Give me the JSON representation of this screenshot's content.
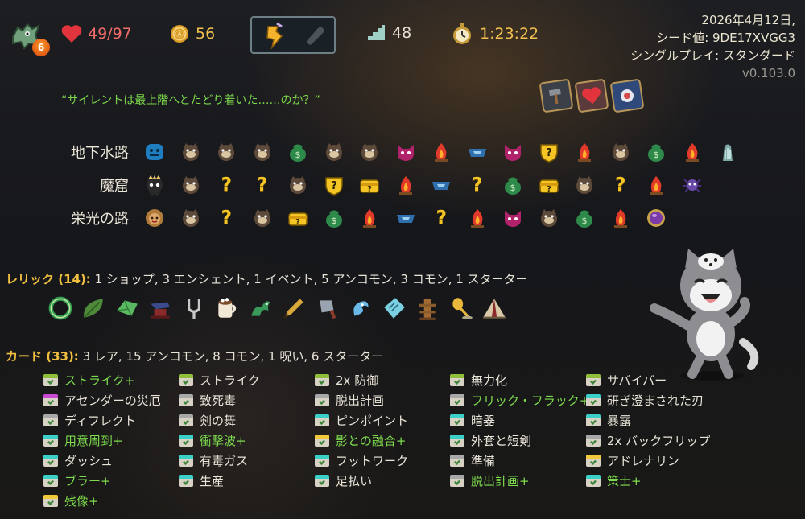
{
  "hud": {
    "ascension": "6",
    "hp": "49/97",
    "gold": "56",
    "floor": "48",
    "time": "1:23:22",
    "colors": {
      "hp": "#f26b6b",
      "gold": "#f2c04e",
      "upgraded": "#7ddc4d",
      "header": "#f0bf3f"
    }
  },
  "run_info": {
    "date": "2026年4月12日,",
    "seed": "シード値: 9DE17XVGG3",
    "mode": "シングルプレイ: スタンダード",
    "version": "v0.103.0"
  },
  "quote": "“サイレントは最上階へとたどり着いた……のか？”",
  "paths": [
    {
      "label": "地下水路",
      "nodes": [
        "boss-water",
        "monster",
        "monster",
        "monster",
        "treasure",
        "monster",
        "monster",
        "elite",
        "rest",
        "shop",
        "elite",
        "unknown-shield",
        "rest",
        "monster",
        "treasure",
        "rest",
        "ancient"
      ]
    },
    {
      "label": "魔窟",
      "nodes": [
        "boss-ghost",
        "monster",
        "unknown",
        "unknown",
        "monster",
        "unknown-shield",
        "unknown-chest",
        "rest",
        "shop",
        "unknown",
        "treasure",
        "unknown-chest",
        "monster",
        "unknown",
        "rest",
        "boss-spider"
      ]
    },
    {
      "label": "栄光の路",
      "nodes": [
        "boss-lion",
        "monster",
        "unknown",
        "monster",
        "unknown-chest",
        "treasure",
        "rest",
        "shop",
        "unknown",
        "rest",
        "elite",
        "monster",
        "treasure",
        "rest",
        "gem"
      ]
    }
  ],
  "relics_section": {
    "heading": "レリック (14):",
    "summary": "1 ショップ,  3 エンシェント,  1 イベント,  5 アンコモン,  3 コモン,  1 スターター",
    "icons": [
      "ring-snake-icon",
      "leaf-icon",
      "emerald-icon",
      "anvil-icon",
      "tuning-fork-icon",
      "cocoa-mug-icon",
      "dragon-icon",
      "pen-icon",
      "cleaver-icon",
      "wisp-icon",
      "ticket-icon",
      "wooden-dummy-icon",
      "spoon-icon",
      "tent-icon"
    ]
  },
  "cards_section": {
    "heading": "カード (33):",
    "summary": "3 レア,  15 アンコモン,  8 コモン,  1 呪い,  6 スターター",
    "columns": [
      [
        {
          "name": "ストライク+",
          "upgraded": true,
          "rarity": "starter"
        },
        {
          "name": "アセンダーの災厄",
          "upgraded": false,
          "rarity": "curse"
        },
        {
          "name": "ディフレクト",
          "upgraded": false,
          "rarity": "common"
        },
        {
          "name": "用意周到+",
          "upgraded": true,
          "rarity": "uncommon"
        },
        {
          "name": "ダッシュ",
          "upgraded": false,
          "rarity": "uncommon"
        },
        {
          "name": "ブラー+",
          "upgraded": true,
          "rarity": "uncommon"
        },
        {
          "name": "残像+",
          "upgraded": true,
          "rarity": "rare"
        }
      ],
      [
        {
          "name": "ストライク",
          "upgraded": false,
          "rarity": "starter"
        },
        {
          "name": "致死毒",
          "upgraded": false,
          "rarity": "common"
        },
        {
          "name": "剣の舞",
          "upgraded": false,
          "rarity": "common"
        },
        {
          "name": "衝撃波+",
          "upgraded": true,
          "rarity": "uncommon"
        },
        {
          "name": "有毒ガス",
          "upgraded": false,
          "rarity": "uncommon"
        },
        {
          "name": "生産",
          "upgraded": false,
          "rarity": "uncommon"
        }
      ],
      [
        {
          "name": "2x 防御",
          "upgraded": false,
          "rarity": "starter"
        },
        {
          "name": "脱出計画",
          "upgraded": false,
          "rarity": "common"
        },
        {
          "name": "ピンポイント",
          "upgraded": false,
          "rarity": "uncommon"
        },
        {
          "name": "影との融合+",
          "upgraded": true,
          "rarity": "rare"
        },
        {
          "name": "フットワーク",
          "upgraded": false,
          "rarity": "uncommon"
        },
        {
          "name": "足払い",
          "upgraded": false,
          "rarity": "uncommon"
        }
      ],
      [
        {
          "name": "無力化",
          "upgraded": false,
          "rarity": "starter"
        },
        {
          "name": "フリック・フラック+",
          "upgraded": true,
          "rarity": "common"
        },
        {
          "name": "暗器",
          "upgraded": false,
          "rarity": "uncommon"
        },
        {
          "name": "外套と短剣",
          "upgraded": false,
          "rarity": "uncommon"
        },
        {
          "name": "準備",
          "upgraded": false,
          "rarity": "common"
        },
        {
          "name": "脱出計画+",
          "upgraded": true,
          "rarity": "common"
        }
      ],
      [
        {
          "name": "サバイバー",
          "upgraded": false,
          "rarity": "starter"
        },
        {
          "name": "研ぎ澄まされた刃",
          "upgraded": false,
          "rarity": "uncommon"
        },
        {
          "name": "暴露",
          "upgraded": false,
          "rarity": "uncommon"
        },
        {
          "name": "2x バックフリップ",
          "upgraded": false,
          "rarity": "common"
        },
        {
          "name": "アドレナリン",
          "upgraded": false,
          "rarity": "rare"
        },
        {
          "name": "策士+",
          "upgraded": true,
          "rarity": "uncommon"
        }
      ]
    ]
  }
}
